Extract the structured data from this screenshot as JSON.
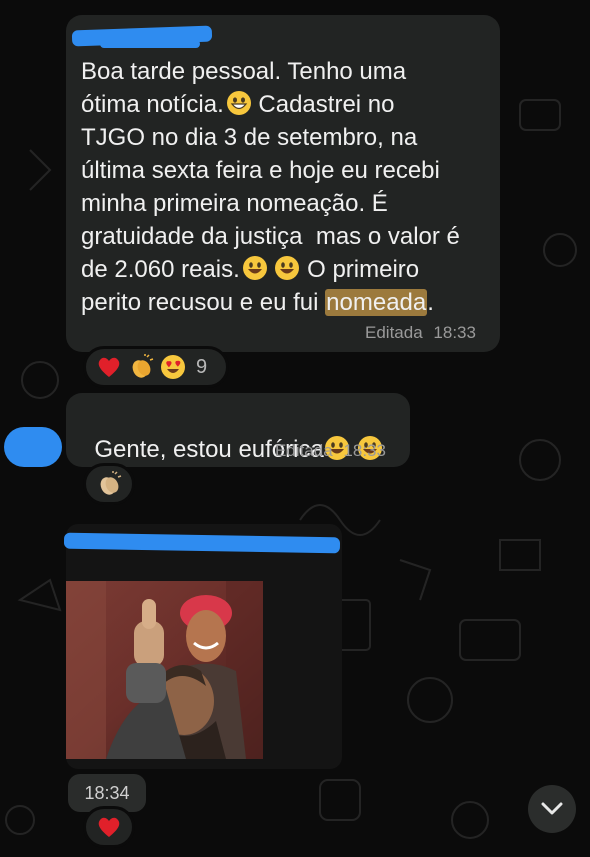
{
  "messages": [
    {
      "id": "msg1",
      "text_before_highlight": "Boa tarde pessoal. Tenho uma\nótima notícia.",
      "text_mid1": " Cadastrei no\nTJGO no dia 3 de setembro, na\núltima sexta feira e hoje eu recebi\nminha primeira nomeação. É\ngratuidade da justiça  mas o valor é\nde 2.060 reais.",
      "text_mid2": " O primeiro\nperito recusou e eu fui ",
      "highlight": "nomeada",
      "text_after": ".",
      "edited_label": "Editada",
      "time": "18:33",
      "reactions": [
        "red-heart",
        "clapping-hands",
        "heart-eyes"
      ],
      "reaction_count": "9"
    },
    {
      "id": "msg2",
      "text": "Gente, estou eufórica",
      "edited_label": "Editada",
      "time": "18:33",
      "reactions": [
        "clapping-hands"
      ]
    },
    {
      "id": "msg3",
      "type": "image",
      "image_description": "person giving a thumbs up",
      "time": "18:34",
      "reactions": [
        "red-heart"
      ]
    }
  ],
  "colors": {
    "bubble": "#222423",
    "background": "#0b0b0b",
    "redaction": "#2f8cf0",
    "highlight": "#9c7a3d"
  },
  "icons": [
    "grinning-emoji",
    "smiley-emoji",
    "red-heart",
    "clapping-hands",
    "heart-eyes",
    "chevron-down-icon"
  ]
}
